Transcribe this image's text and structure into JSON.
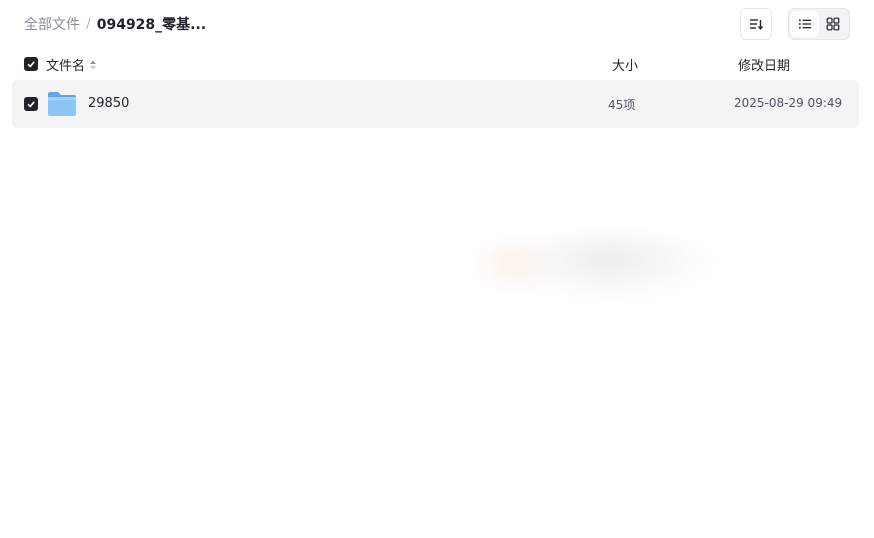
{
  "breadcrumb": {
    "root": "全部文件",
    "separator": "/",
    "current": "094928_零基..."
  },
  "toolbar": {
    "sort_icon": "sort-icon",
    "view_modes": [
      "list",
      "grid"
    ],
    "active_view": "list"
  },
  "table": {
    "headers": {
      "name": "文件名",
      "size": "大小",
      "modified": "修改日期"
    },
    "select_all_checked": true,
    "rows": [
      {
        "icon": "folder-icon",
        "name": "29850",
        "size": "45项",
        "modified": "2025-08-29 09:49",
        "checked": true
      }
    ]
  },
  "colors": {
    "row_bg": "#f4f4f5",
    "checkbox": "#1f2329",
    "folder": "#7cb9f2",
    "muted_text": "#8a8f99"
  }
}
